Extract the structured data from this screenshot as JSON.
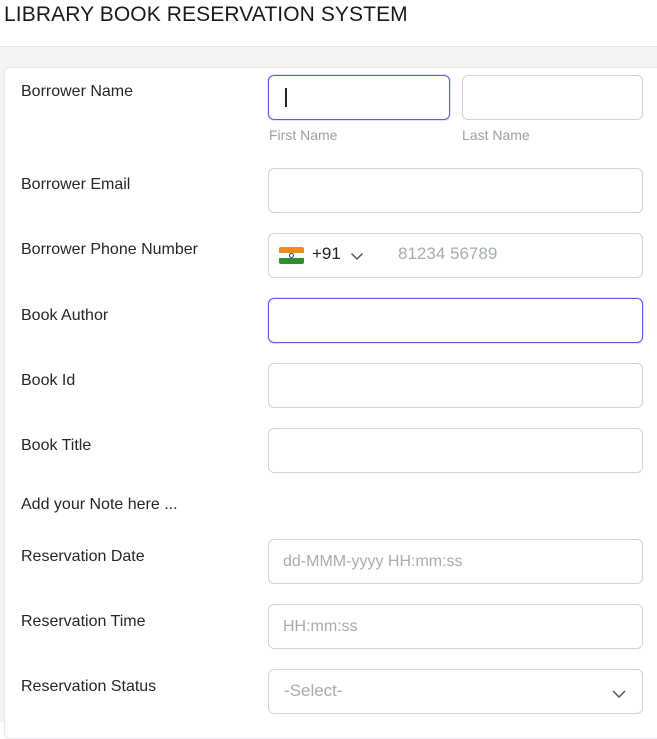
{
  "page": {
    "title": "LIBRARY BOOK RESERVATION SYSTEM"
  },
  "form": {
    "borrower_name": {
      "label": "Borrower Name",
      "first_sublabel": "First Name",
      "last_sublabel": "Last Name",
      "first_value": "",
      "last_value": ""
    },
    "borrower_email": {
      "label": "Borrower Email",
      "value": ""
    },
    "borrower_phone": {
      "label": "Borrower Phone Number",
      "country_code": "+91",
      "flag_icon": "india-flag-icon",
      "placeholder": "81234 56789"
    },
    "book_author": {
      "label": "Book Author",
      "value": ""
    },
    "book_id": {
      "label": "Book Id",
      "value": ""
    },
    "book_title": {
      "label": "Book Title",
      "value": ""
    },
    "note": {
      "text": "Add your Note here ..."
    },
    "reservation_date": {
      "label": "Reservation Date",
      "placeholder": "dd-MMM-yyyy HH:mm:ss"
    },
    "reservation_time": {
      "label": "Reservation Time",
      "placeholder": "HH:mm:ss"
    },
    "reservation_status": {
      "label": "Reservation Status",
      "selected": "-Select-"
    }
  },
  "colors": {
    "focus_border": "#5b5fd6",
    "field_border": "#cfd3da",
    "placeholder": "#a7abb3",
    "band": "#f3f4f6"
  }
}
